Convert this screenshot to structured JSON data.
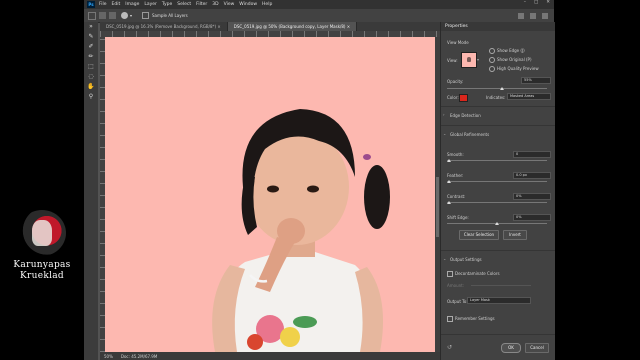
{
  "watermark": {
    "line1": "Karunyapas",
    "line2": "Krueklad"
  },
  "menubar": {
    "logo": "Ps",
    "items": [
      "File",
      "Edit",
      "Image",
      "Layer",
      "Type",
      "Select",
      "Filter",
      "3D",
      "View",
      "Window",
      "Help"
    ]
  },
  "options_bar": {
    "sample_all_layers": "Sample All Layers"
  },
  "tabs": [
    {
      "label": "DSC_0519.jpg @ 16.3% (Remove Background, RGB/8*) ×"
    },
    {
      "label": "DSC_0519.jpg @ 50% (Background copy, Layer Mask/8) ×"
    }
  ],
  "status": {
    "zoom": "50%",
    "doc": "Doc: 45.2M/67.9M"
  },
  "properties": {
    "title": "Properties",
    "view_mode_label": "View Mode",
    "view_label": "View:",
    "show_edge": "Show Edge (J)",
    "show_original": "Show Original (P)",
    "high_quality_preview": "High Quality Preview",
    "opacity_label": "Opacity:",
    "opacity_value": "55%",
    "opacity_fraction": 0.55,
    "color_label": "Color:",
    "color_value": "#d9261c",
    "indicates_label": "Indicates:",
    "indicates_value": "Masked Areas",
    "edge_detection": "Edge Detection",
    "global_refinements": "Global Refinements",
    "smooth_label": "Smooth:",
    "smooth_value": "0",
    "feather_label": "Feather:",
    "feather_value": "0.0 px",
    "contrast_label": "Contrast:",
    "contrast_value": "0%",
    "shift_edge_label": "Shift Edge:",
    "shift_edge_value": "0%",
    "clear_selection": "Clear Selection",
    "invert": "Invert",
    "output_settings": "Output Settings",
    "decontaminate": "Decontaminate Colors",
    "amount_label": "Amount:",
    "output_to_label": "Output To:",
    "output_to_value": "Layer Mask",
    "remember_settings": "Remember Settings",
    "ok": "OK",
    "cancel": "Cancel"
  }
}
